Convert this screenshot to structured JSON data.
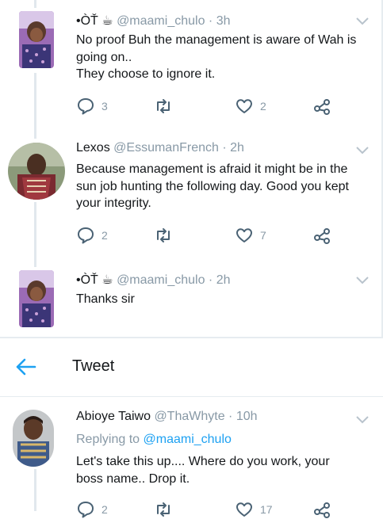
{
  "colors": {
    "accent": "#1da1f2",
    "muted": "#8899a6",
    "text": "#14171a",
    "divider": "#e6ecf0"
  },
  "tweets": [
    {
      "display_name": "•ÒŤ ☕",
      "handle": "@maami_chulo",
      "time": "· 3h",
      "text_lines": [
        "No proof Buh the management is aware of Wah is",
        "going on..",
        "They choose to ignore it."
      ],
      "reply_count": "3",
      "retweet_count": "",
      "like_count": "2"
    },
    {
      "display_name": "Lexos",
      "handle": "@EssumanFrench",
      "time": "· 2h",
      "text_lines": [
        "Because management is afraid it might be in the",
        "sun job hunting the following day. Good you kept",
        "your integrity."
      ],
      "reply_count": "2",
      "retweet_count": "",
      "like_count": "7"
    },
    {
      "display_name": "•ÒŤ ☕",
      "handle": "@maami_chulo",
      "time": "· 2h",
      "text_lines": [
        "Thanks sir"
      ]
    }
  ],
  "nav": {
    "title": "Tweet",
    "back_icon": "arrow-left-icon"
  },
  "focused_tweet": {
    "display_name": "Abioye Taiwo",
    "handle": "@ThaWhyte",
    "time": "· 10h",
    "replying_prefix": "Replying to",
    "replying_handle": "@maami_chulo",
    "text_lines": [
      "Let's take this up....  Where do you work,  your",
      "boss name..  Drop it."
    ],
    "reply_count": "2",
    "like_count": "17"
  }
}
